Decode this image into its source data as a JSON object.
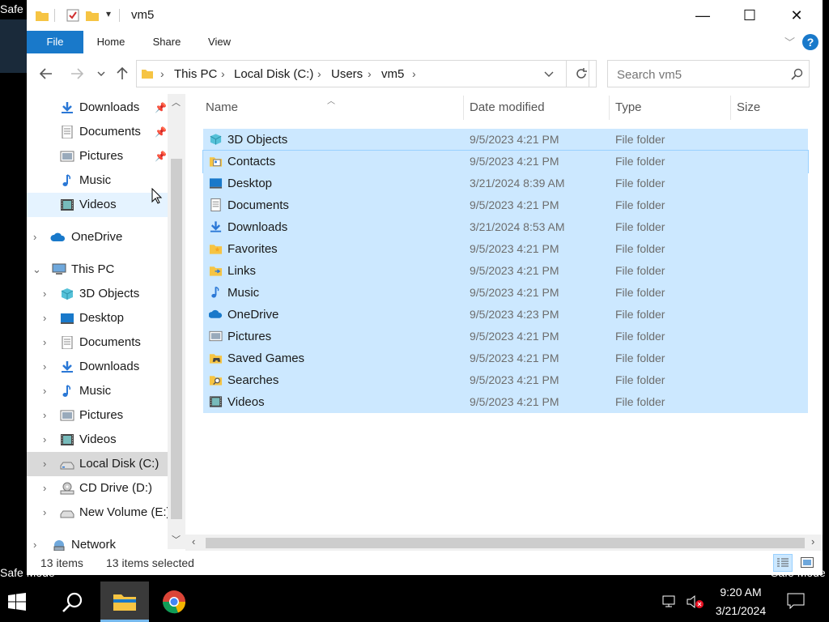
{
  "desktop": {
    "safe_mode_left": "Safe Mode",
    "safe_mode_right": "Safe Mode",
    "top_left_text": "Safe"
  },
  "window": {
    "title": "vm5",
    "minimize_glyph": "—",
    "maximize_glyph": "☐",
    "close_glyph": "✕"
  },
  "ribbon": {
    "tabs": [
      "File",
      "Home",
      "Share",
      "View"
    ],
    "help_glyph": "?"
  },
  "address": {
    "crumbs": [
      "This PC",
      "Local Disk (C:)",
      "Users",
      "vm5"
    ],
    "search_placeholder": "Search vm5"
  },
  "nav": {
    "quick_access": [
      {
        "label": "Downloads",
        "icon": "download-icon",
        "pinned": true
      },
      {
        "label": "Documents",
        "icon": "document-icon",
        "pinned": true
      },
      {
        "label": "Pictures",
        "icon": "pictures-icon",
        "pinned": true
      },
      {
        "label": "Music",
        "icon": "music-icon",
        "pinned": false
      },
      {
        "label": "Videos",
        "icon": "video-icon",
        "pinned": false
      }
    ],
    "onedrive": "OneDrive",
    "this_pc": "This PC",
    "this_pc_children": [
      {
        "label": "3D Objects",
        "icon": "3d-objects-icon"
      },
      {
        "label": "Desktop",
        "icon": "desktop-icon"
      },
      {
        "label": "Documents",
        "icon": "document-icon"
      },
      {
        "label": "Downloads",
        "icon": "download-icon"
      },
      {
        "label": "Music",
        "icon": "music-icon"
      },
      {
        "label": "Pictures",
        "icon": "pictures-icon"
      },
      {
        "label": "Videos",
        "icon": "video-icon"
      },
      {
        "label": "Local Disk (C:)",
        "icon": "drive-icon",
        "selected": true
      },
      {
        "label": "CD Drive (D:)",
        "icon": "cd-drive-icon"
      },
      {
        "label": "New Volume (E:)",
        "icon": "drive-icon"
      }
    ],
    "network": "Network"
  },
  "columns": {
    "name": "Name",
    "date": "Date modified",
    "type": "Type",
    "size": "Size"
  },
  "files": [
    {
      "name": "3D Objects",
      "date": "9/5/2023 4:21 PM",
      "type": "File folder",
      "icon": "3d-objects-icon"
    },
    {
      "name": "Contacts",
      "date": "9/5/2023 4:21 PM",
      "type": "File folder",
      "icon": "contacts-icon"
    },
    {
      "name": "Desktop",
      "date": "3/21/2024 8:39 AM",
      "type": "File folder",
      "icon": "desktop-icon"
    },
    {
      "name": "Documents",
      "date": "9/5/2023 4:21 PM",
      "type": "File folder",
      "icon": "document-icon"
    },
    {
      "name": "Downloads",
      "date": "3/21/2024 8:53 AM",
      "type": "File folder",
      "icon": "download-icon"
    },
    {
      "name": "Favorites",
      "date": "9/5/2023 4:21 PM",
      "type": "File folder",
      "icon": "favorites-icon"
    },
    {
      "name": "Links",
      "date": "9/5/2023 4:21 PM",
      "type": "File folder",
      "icon": "links-icon"
    },
    {
      "name": "Music",
      "date": "9/5/2023 4:21 PM",
      "type": "File folder",
      "icon": "music-icon"
    },
    {
      "name": "OneDrive",
      "date": "9/5/2023 4:23 PM",
      "type": "File folder",
      "icon": "onedrive-icon"
    },
    {
      "name": "Pictures",
      "date": "9/5/2023 4:21 PM",
      "type": "File folder",
      "icon": "pictures-icon"
    },
    {
      "name": "Saved Games",
      "date": "9/5/2023 4:21 PM",
      "type": "File folder",
      "icon": "saved-games-icon"
    },
    {
      "name": "Searches",
      "date": "9/5/2023 4:21 PM",
      "type": "File folder",
      "icon": "searches-icon"
    },
    {
      "name": "Videos",
      "date": "9/5/2023 4:21 PM",
      "type": "File folder",
      "icon": "video-icon"
    }
  ],
  "status": {
    "item_count": "13 items",
    "selected_count": "13 items selected"
  },
  "taskbar": {
    "time": "9:20 AM",
    "date": "3/21/2024"
  },
  "colors": {
    "selection": "#cce8ff",
    "accent": "#1979ca",
    "taskbar": "#000000"
  }
}
